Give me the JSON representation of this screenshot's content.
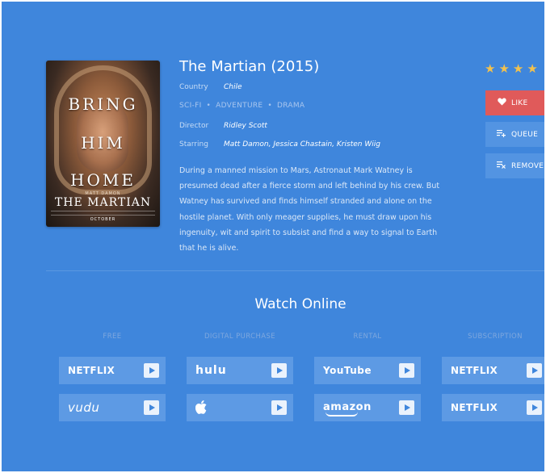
{
  "movie": {
    "title": "The Martian (2015)",
    "country_label": "Country",
    "country": "Chile",
    "genres": [
      "SCI-FI",
      "ADVENTURE",
      "DRAMA"
    ],
    "director_label": "Director",
    "director": "Ridley Scott",
    "starring_label": "Starring",
    "starring": "Matt Damon, Jessica Chastain, Kristen Wiig",
    "synopsis": "During a manned mission to Mars, Astronaut Mark Watney is presumed dead after a fierce storm and left behind by his crew. But Watney has survived and finds himself stranded and alone on the hostile planet. With only meager supplies, he must draw upon his ingenuity, wit and spirit to subsist and find a way to signal to Earth that he is alive.",
    "rating_stars": 4
  },
  "poster": {
    "line1": "BRING",
    "line2": "HIM",
    "line3": "HOME",
    "small": "MATT DAMON",
    "title": "THE MARTIAN",
    "date": "OCTOBER"
  },
  "actions": {
    "like": "LIKE",
    "queue": "QUEUE",
    "remove": "REMOVE"
  },
  "watch": {
    "title": "Watch Online",
    "columns": [
      "FREE",
      "DIGITAL PURCHASE",
      "RENTAL",
      "SUBSCRIPTION"
    ],
    "providers": [
      [
        "NETFLIX",
        "vudu"
      ],
      [
        "hulu",
        "apple"
      ],
      [
        "YouTube",
        "amazon"
      ],
      [
        "NETFLIX",
        "NETFLIX"
      ]
    ]
  },
  "colors": {
    "background": "#3f86dc",
    "like": "#e05a5a",
    "button": "#5394e2",
    "star": "#f2c14e"
  },
  "icons": {
    "like": "heart-icon",
    "queue": "queue-add-icon",
    "remove": "queue-remove-icon",
    "play": "play-icon"
  }
}
